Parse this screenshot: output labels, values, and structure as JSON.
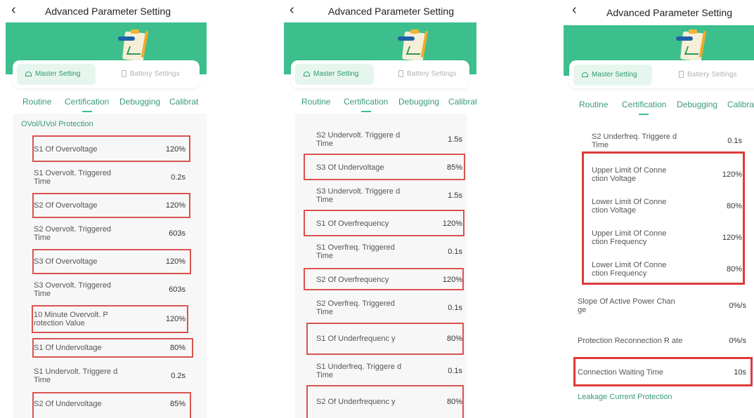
{
  "header": {
    "title": "Advanced Parameter Setting",
    "back_icon": "chevron-left-icon"
  },
  "segment": {
    "master": "Master Setting",
    "battery": "Battery Settings"
  },
  "tabs": [
    "Routine",
    "Certification",
    "Debugging",
    "Calibrat"
  ],
  "colors": {
    "accent": "#3cbf8d",
    "highlight": "#d9534f"
  },
  "screen1": {
    "section": "OVol/UVol Protection",
    "rows": [
      {
        "label": "S1 Of Overvoltage",
        "value": "120%"
      },
      {
        "label": "S1 Overvolt. Triggered Time",
        "value": "0.2s"
      },
      {
        "label": "S2 Of Overvoltage",
        "value": "120%"
      },
      {
        "label": "S2 Overvolt. Triggered Time",
        "value": "603s"
      },
      {
        "label": "S3 Of Overvoltage",
        "value": "120%"
      },
      {
        "label": "S3 Overvolt. Triggered Time",
        "value": "603s"
      },
      {
        "label": "10 Minute Overvolt. P rotection Value",
        "value": "120%"
      },
      {
        "label": "S1 Of Undervoltage",
        "value": "80%"
      },
      {
        "label": "S1 Undervolt. Triggere d Time",
        "value": "0.2s"
      },
      {
        "label": "S2 Of Undervoltage",
        "value": "85%"
      }
    ]
  },
  "screen2": {
    "rows": [
      {
        "label": "S2 Undervolt. Triggere d Time",
        "value": "1.5s"
      },
      {
        "label": "S3 Of Undervoltage",
        "value": "85%"
      },
      {
        "label": "S3 Undervolt. Triggere d Time",
        "value": "1.5s"
      },
      {
        "label": "S1 Of Overfrequency",
        "value": "120%"
      },
      {
        "label": "S1 Overfreq. Triggered Time",
        "value": "0.1s"
      },
      {
        "label": "S2 Of Overfrequency",
        "value": "120%"
      },
      {
        "label": "S2 Overfreq. Triggered Time",
        "value": "0.1s"
      },
      {
        "label": "S1 Of Underfrequenc y",
        "value": "80%"
      },
      {
        "label": "S1 Underfreq. Triggere d Time",
        "value": "0.1s"
      },
      {
        "label": "S2 Of Underfrequenc y",
        "value": "80%"
      }
    ]
  },
  "screen3": {
    "rows": [
      {
        "label": "S2 Underfreq. Triggere d Time",
        "value": "0.1s"
      },
      {
        "label": "Upper Limit Of Conne ction Voltage",
        "value": "120%"
      },
      {
        "label": "Lower Limit Of Conne ction Voltage",
        "value": "80%"
      },
      {
        "label": "Upper Limit Of Conne ction Frequency",
        "value": "120%"
      },
      {
        "label": "Lower Limit Of Conne ction Frequency",
        "value": "80%"
      },
      {
        "label": "Slope Of Active Power Chan ge",
        "value": "0%/s"
      },
      {
        "label": "Protection Reconnection R ate",
        "value": "0%/s"
      },
      {
        "label": "Connection Waiting Time",
        "value": "10s"
      }
    ],
    "section": "Leakage Current Protection"
  }
}
